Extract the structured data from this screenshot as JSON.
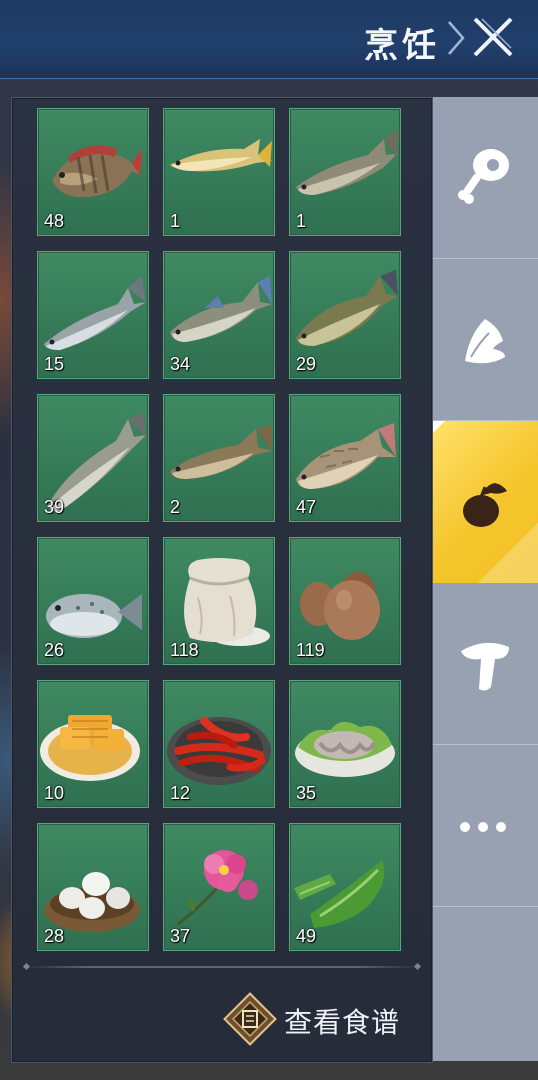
{
  "header": {
    "title": "烹饪",
    "close_icon": "close-icon",
    "chevron_icon": "chevron-right-icon"
  },
  "tabs": [
    {
      "icon": "meat-leg-icon",
      "active": false
    },
    {
      "icon": "leafy-vegetable-icon",
      "active": false
    },
    {
      "icon": "fruit-nut-icon",
      "active": true
    },
    {
      "icon": "mushroom-icon",
      "active": false
    },
    {
      "icon": "more-icon",
      "active": false
    }
  ],
  "items": [
    {
      "icon": "red-fin-fish-icon",
      "count": "48"
    },
    {
      "icon": "golden-fish-icon",
      "count": "1"
    },
    {
      "icon": "slim-gray-fish-icon",
      "count": "1"
    },
    {
      "icon": "silver-fish-icon",
      "count": "15"
    },
    {
      "icon": "blue-fin-fish-icon",
      "count": "34"
    },
    {
      "icon": "olive-fish-icon",
      "count": "29"
    },
    {
      "icon": "long-silver-fish-icon",
      "count": "39"
    },
    {
      "icon": "brown-fish-icon",
      "count": "2"
    },
    {
      "icon": "carp-icon",
      "count": "47"
    },
    {
      "icon": "pufferfish-icon",
      "count": "26"
    },
    {
      "icon": "flour-sack-icon",
      "count": "118"
    },
    {
      "icon": "eggs-icon",
      "count": "119"
    },
    {
      "icon": "honeycomb-plate-icon",
      "count": "10"
    },
    {
      "icon": "chili-peppers-icon",
      "count": "12"
    },
    {
      "icon": "seafood-plate-icon",
      "count": "35"
    },
    {
      "icon": "bird-eggs-nest-icon",
      "count": "28"
    },
    {
      "icon": "pink-flower-icon",
      "count": "37"
    },
    {
      "icon": "aloe-icon",
      "count": "49"
    }
  ],
  "recipe_button": {
    "label": "查看食谱",
    "icon": "recipe-book-icon"
  }
}
